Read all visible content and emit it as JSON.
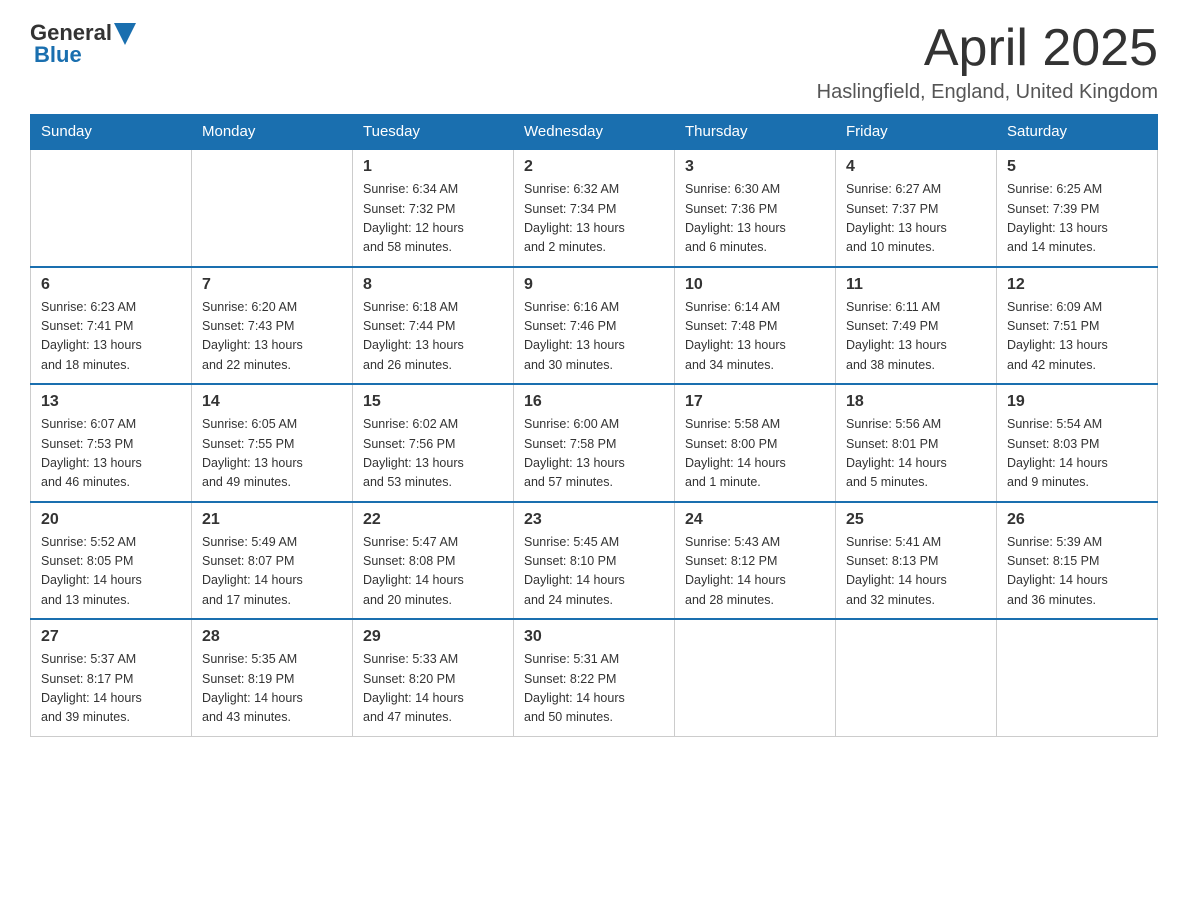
{
  "header": {
    "logo_general": "General",
    "logo_blue": "Blue",
    "month_title": "April 2025",
    "location": "Haslingfield, England, United Kingdom"
  },
  "weekdays": [
    "Sunday",
    "Monday",
    "Tuesday",
    "Wednesday",
    "Thursday",
    "Friday",
    "Saturday"
  ],
  "weeks": [
    [
      {
        "day": "",
        "info": ""
      },
      {
        "day": "",
        "info": ""
      },
      {
        "day": "1",
        "info": "Sunrise: 6:34 AM\nSunset: 7:32 PM\nDaylight: 12 hours\nand 58 minutes."
      },
      {
        "day": "2",
        "info": "Sunrise: 6:32 AM\nSunset: 7:34 PM\nDaylight: 13 hours\nand 2 minutes."
      },
      {
        "day": "3",
        "info": "Sunrise: 6:30 AM\nSunset: 7:36 PM\nDaylight: 13 hours\nand 6 minutes."
      },
      {
        "day": "4",
        "info": "Sunrise: 6:27 AM\nSunset: 7:37 PM\nDaylight: 13 hours\nand 10 minutes."
      },
      {
        "day": "5",
        "info": "Sunrise: 6:25 AM\nSunset: 7:39 PM\nDaylight: 13 hours\nand 14 minutes."
      }
    ],
    [
      {
        "day": "6",
        "info": "Sunrise: 6:23 AM\nSunset: 7:41 PM\nDaylight: 13 hours\nand 18 minutes."
      },
      {
        "day": "7",
        "info": "Sunrise: 6:20 AM\nSunset: 7:43 PM\nDaylight: 13 hours\nand 22 minutes."
      },
      {
        "day": "8",
        "info": "Sunrise: 6:18 AM\nSunset: 7:44 PM\nDaylight: 13 hours\nand 26 minutes."
      },
      {
        "day": "9",
        "info": "Sunrise: 6:16 AM\nSunset: 7:46 PM\nDaylight: 13 hours\nand 30 minutes."
      },
      {
        "day": "10",
        "info": "Sunrise: 6:14 AM\nSunset: 7:48 PM\nDaylight: 13 hours\nand 34 minutes."
      },
      {
        "day": "11",
        "info": "Sunrise: 6:11 AM\nSunset: 7:49 PM\nDaylight: 13 hours\nand 38 minutes."
      },
      {
        "day": "12",
        "info": "Sunrise: 6:09 AM\nSunset: 7:51 PM\nDaylight: 13 hours\nand 42 minutes."
      }
    ],
    [
      {
        "day": "13",
        "info": "Sunrise: 6:07 AM\nSunset: 7:53 PM\nDaylight: 13 hours\nand 46 minutes."
      },
      {
        "day": "14",
        "info": "Sunrise: 6:05 AM\nSunset: 7:55 PM\nDaylight: 13 hours\nand 49 minutes."
      },
      {
        "day": "15",
        "info": "Sunrise: 6:02 AM\nSunset: 7:56 PM\nDaylight: 13 hours\nand 53 minutes."
      },
      {
        "day": "16",
        "info": "Sunrise: 6:00 AM\nSunset: 7:58 PM\nDaylight: 13 hours\nand 57 minutes."
      },
      {
        "day": "17",
        "info": "Sunrise: 5:58 AM\nSunset: 8:00 PM\nDaylight: 14 hours\nand 1 minute."
      },
      {
        "day": "18",
        "info": "Sunrise: 5:56 AM\nSunset: 8:01 PM\nDaylight: 14 hours\nand 5 minutes."
      },
      {
        "day": "19",
        "info": "Sunrise: 5:54 AM\nSunset: 8:03 PM\nDaylight: 14 hours\nand 9 minutes."
      }
    ],
    [
      {
        "day": "20",
        "info": "Sunrise: 5:52 AM\nSunset: 8:05 PM\nDaylight: 14 hours\nand 13 minutes."
      },
      {
        "day": "21",
        "info": "Sunrise: 5:49 AM\nSunset: 8:07 PM\nDaylight: 14 hours\nand 17 minutes."
      },
      {
        "day": "22",
        "info": "Sunrise: 5:47 AM\nSunset: 8:08 PM\nDaylight: 14 hours\nand 20 minutes."
      },
      {
        "day": "23",
        "info": "Sunrise: 5:45 AM\nSunset: 8:10 PM\nDaylight: 14 hours\nand 24 minutes."
      },
      {
        "day": "24",
        "info": "Sunrise: 5:43 AM\nSunset: 8:12 PM\nDaylight: 14 hours\nand 28 minutes."
      },
      {
        "day": "25",
        "info": "Sunrise: 5:41 AM\nSunset: 8:13 PM\nDaylight: 14 hours\nand 32 minutes."
      },
      {
        "day": "26",
        "info": "Sunrise: 5:39 AM\nSunset: 8:15 PM\nDaylight: 14 hours\nand 36 minutes."
      }
    ],
    [
      {
        "day": "27",
        "info": "Sunrise: 5:37 AM\nSunset: 8:17 PM\nDaylight: 14 hours\nand 39 minutes."
      },
      {
        "day": "28",
        "info": "Sunrise: 5:35 AM\nSunset: 8:19 PM\nDaylight: 14 hours\nand 43 minutes."
      },
      {
        "day": "29",
        "info": "Sunrise: 5:33 AM\nSunset: 8:20 PM\nDaylight: 14 hours\nand 47 minutes."
      },
      {
        "day": "30",
        "info": "Sunrise: 5:31 AM\nSunset: 8:22 PM\nDaylight: 14 hours\nand 50 minutes."
      },
      {
        "day": "",
        "info": ""
      },
      {
        "day": "",
        "info": ""
      },
      {
        "day": "",
        "info": ""
      }
    ]
  ]
}
